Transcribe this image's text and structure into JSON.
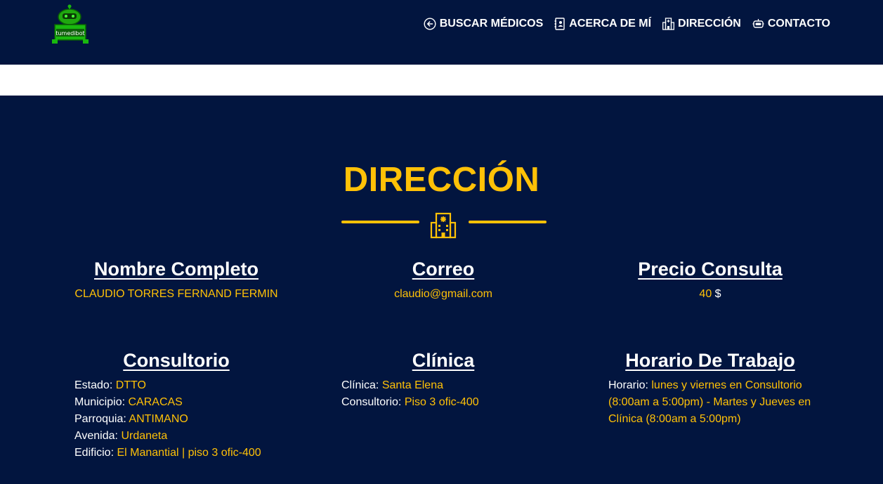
{
  "brand": {
    "logo_text": "tumedibot"
  },
  "nav": {
    "items": [
      {
        "label": "BUSCAR MÉDICOS",
        "icon": "arrow-left-circle-icon"
      },
      {
        "label": "ACERCA DE MÍ",
        "icon": "contact-card-icon"
      },
      {
        "label": "DIRECCIÓN",
        "icon": "hospital-building-icon"
      },
      {
        "label": "CONTACTO",
        "icon": "robot-icon"
      }
    ]
  },
  "section": {
    "title": "DIRECCIÓN",
    "divider_icon": "hospital-building-icon"
  },
  "info": {
    "nombre": {
      "heading": "Nombre Completo",
      "value": "CLAUDIO TORRES FERNAND FERMIN"
    },
    "correo": {
      "heading": "Correo",
      "value": "claudio@gmail.com"
    },
    "precio": {
      "heading": "Precio Consulta",
      "value": "40",
      "unit": "$"
    },
    "consultorio": {
      "heading": "Consultorio",
      "rows": [
        {
          "key": "Estado:",
          "value": "DTTO"
        },
        {
          "key": "Municipio:",
          "value": "CARACAS"
        },
        {
          "key": "Parroquia:",
          "value": "ANTIMANO"
        },
        {
          "key": "Avenida:",
          "value": "Urdaneta"
        },
        {
          "key": "Edificio:",
          "value": "El Manantial | piso 3 ofic-400"
        }
      ]
    },
    "clinica": {
      "heading": "Clínica",
      "rows": [
        {
          "key": "Clínica:",
          "value": "Santa Elena"
        },
        {
          "key": "Consultorio:",
          "value": "Piso 3 ofic-400"
        }
      ]
    },
    "horario": {
      "heading": "Horario De Trabajo",
      "key": "Horario:",
      "value": "lunes y viernes en Consultorio (8:00am a 5:00pm) - Martes y Jueves en Clínica (8:00am a 5:00pm)"
    }
  },
  "colors": {
    "background": "#02153f",
    "accent": "#ffc107",
    "text": "#ffffff",
    "logo_green": "#19b80f"
  }
}
